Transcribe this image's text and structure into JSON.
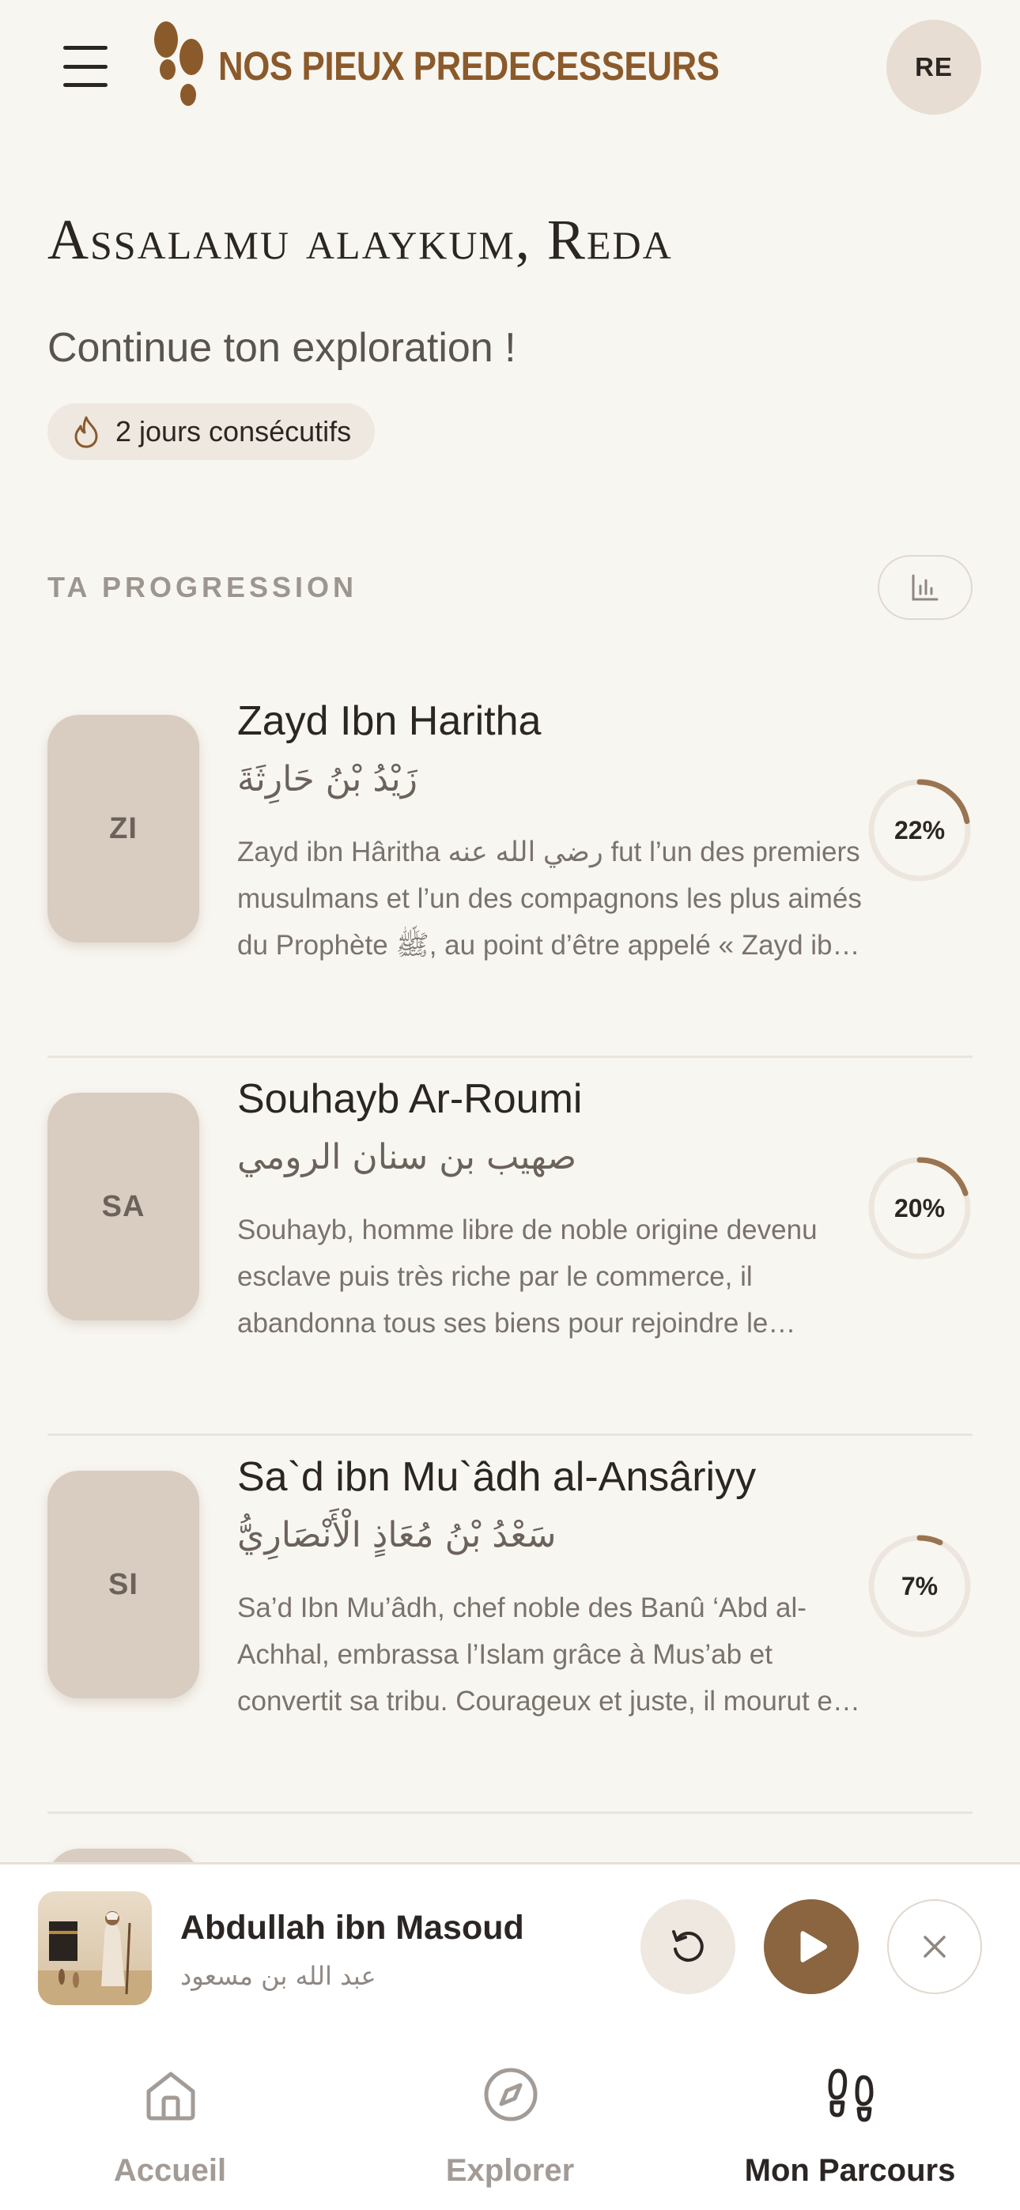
{
  "header": {
    "app_name": "NOS PIEUX PREDECESSEURS",
    "avatar_initials": "RE",
    "brand_color": "#8b5a2b"
  },
  "home": {
    "greeting": "Assalamu alaykum, Reda",
    "subtitle": "Continue ton exploration !",
    "streak_label": "2 jours consécutifs",
    "streak_icon": "flame-icon"
  },
  "progression": {
    "title": "TA PROGRESSION",
    "stats_icon": "bar-chart-icon",
    "items": [
      {
        "initials": "ZI",
        "name": "Zayd Ibn Haritha",
        "arabic": "زَيْدُ بْنُ حَارِثَةَ",
        "description": "Zayd ibn Hâritha رضي الله عنه fut l’un des premiers musulmans et l’un des compagnons les plus aimés du Prophète ﷺ, au point d’être appelé « Zayd ibn Muhammad » avant que l’adoption ne soit abolie.",
        "progress": 22,
        "progress_label": "22%"
      },
      {
        "initials": "SA",
        "name": "Souhayb Ar-Roumi",
        "arabic": "صهيب بن سنان الرومي",
        "description": "Souhayb, homme libre de noble origine devenu esclave puis très riche par le commerce, il abandonna tous ses biens pour rejoindre le Prophète ﷺ à Médine.",
        "progress": 20,
        "progress_label": "20%"
      },
      {
        "initials": "SI",
        "name": "Sa`d ibn Mu`âdh al-Ansâriyy",
        "arabic": "سَعْدُ بْنُ مُعَاذٍ الْأَنْصَارِيُّ",
        "description": "Sa’d Ibn Mu’âdh, chef noble des Banû ‘Abd al-Achhal, embrassa l’Islam grâce à Mus’ab et convertit sa tribu. Courageux et juste, il mourut en martyr.",
        "progress": 7,
        "progress_label": "7%"
      }
    ]
  },
  "player": {
    "title": "Abdullah ibn Masoud",
    "subtitle_arabic": "عبد الله بن مسعود",
    "replay_icon": "replay-icon",
    "play_icon": "play-icon",
    "close_icon": "close-icon"
  },
  "nav": {
    "items": [
      {
        "label": "Accueil",
        "icon": "home-icon",
        "active": false
      },
      {
        "label": "Explorer",
        "icon": "compass-icon",
        "active": false
      },
      {
        "label": "Mon Parcours",
        "icon": "footprints-icon",
        "active": true
      }
    ]
  },
  "colors": {
    "background": "#f8f6f1",
    "accent": "#8b6440",
    "card_thumb": "#d9ccc1",
    "muted_text": "#7a726c"
  }
}
